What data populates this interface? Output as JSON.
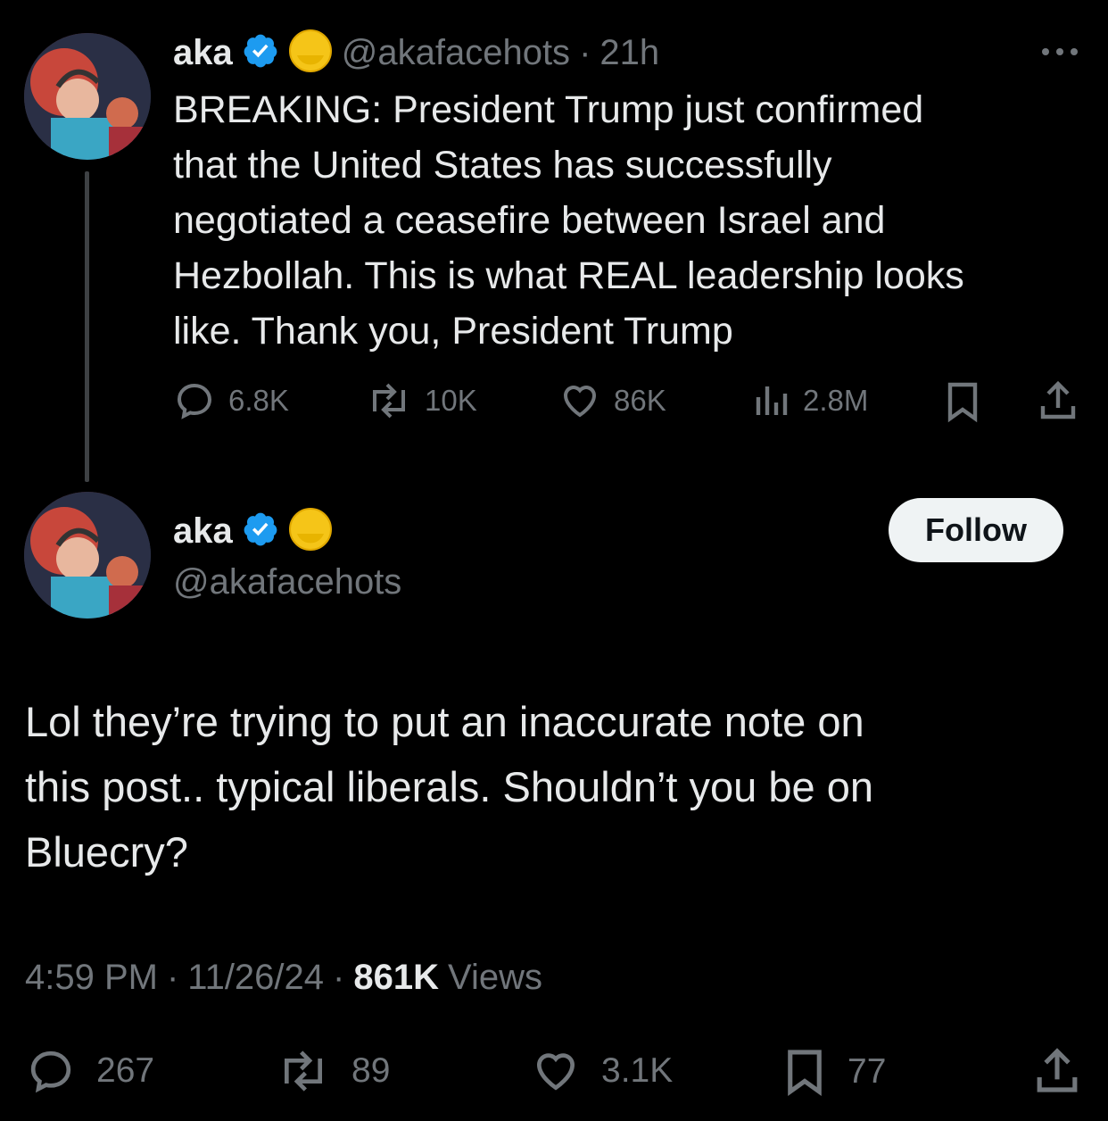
{
  "parent": {
    "name": "aka",
    "handle": "@akafacehots",
    "sep": "·",
    "time": "21h",
    "text_lines": [
      "BREAKING: President Trump just confirmed",
      "that the United States has successfully",
      "negotiated a ceasefire between Israel and",
      "Hezbollah. This is what REAL leadership looks",
      "like. Thank you, President Trump"
    ],
    "replies": "6.8K",
    "reposts": "10K",
    "likes": "86K",
    "views": "2.8M"
  },
  "main": {
    "name": "aka",
    "handle": "@akafacehots",
    "follow_label": "Follow",
    "text_lines": [
      "Lol they’re trying to put an inaccurate note on",
      "this post.. typical liberals. Shouldn’t you be on",
      "Bluecry?"
    ],
    "time": "4:59 PM",
    "sep": "·",
    "date": "11/26/24",
    "views_count": "861K",
    "views_label": "Views",
    "replies": "267",
    "reposts": "89",
    "likes": "3.1K",
    "bookmarks": "77"
  },
  "colors": {
    "background": "#000000",
    "text": "#e7e9ea",
    "secondary": "#71767b",
    "verified": "#1d9bf0",
    "follow_bg": "#eff3f4"
  },
  "icons": [
    "more-icon",
    "verified-badge-icon",
    "emoji-icon",
    "reply-icon",
    "repost-icon",
    "like-icon",
    "views-icon",
    "bookmark-icon",
    "share-icon"
  ]
}
